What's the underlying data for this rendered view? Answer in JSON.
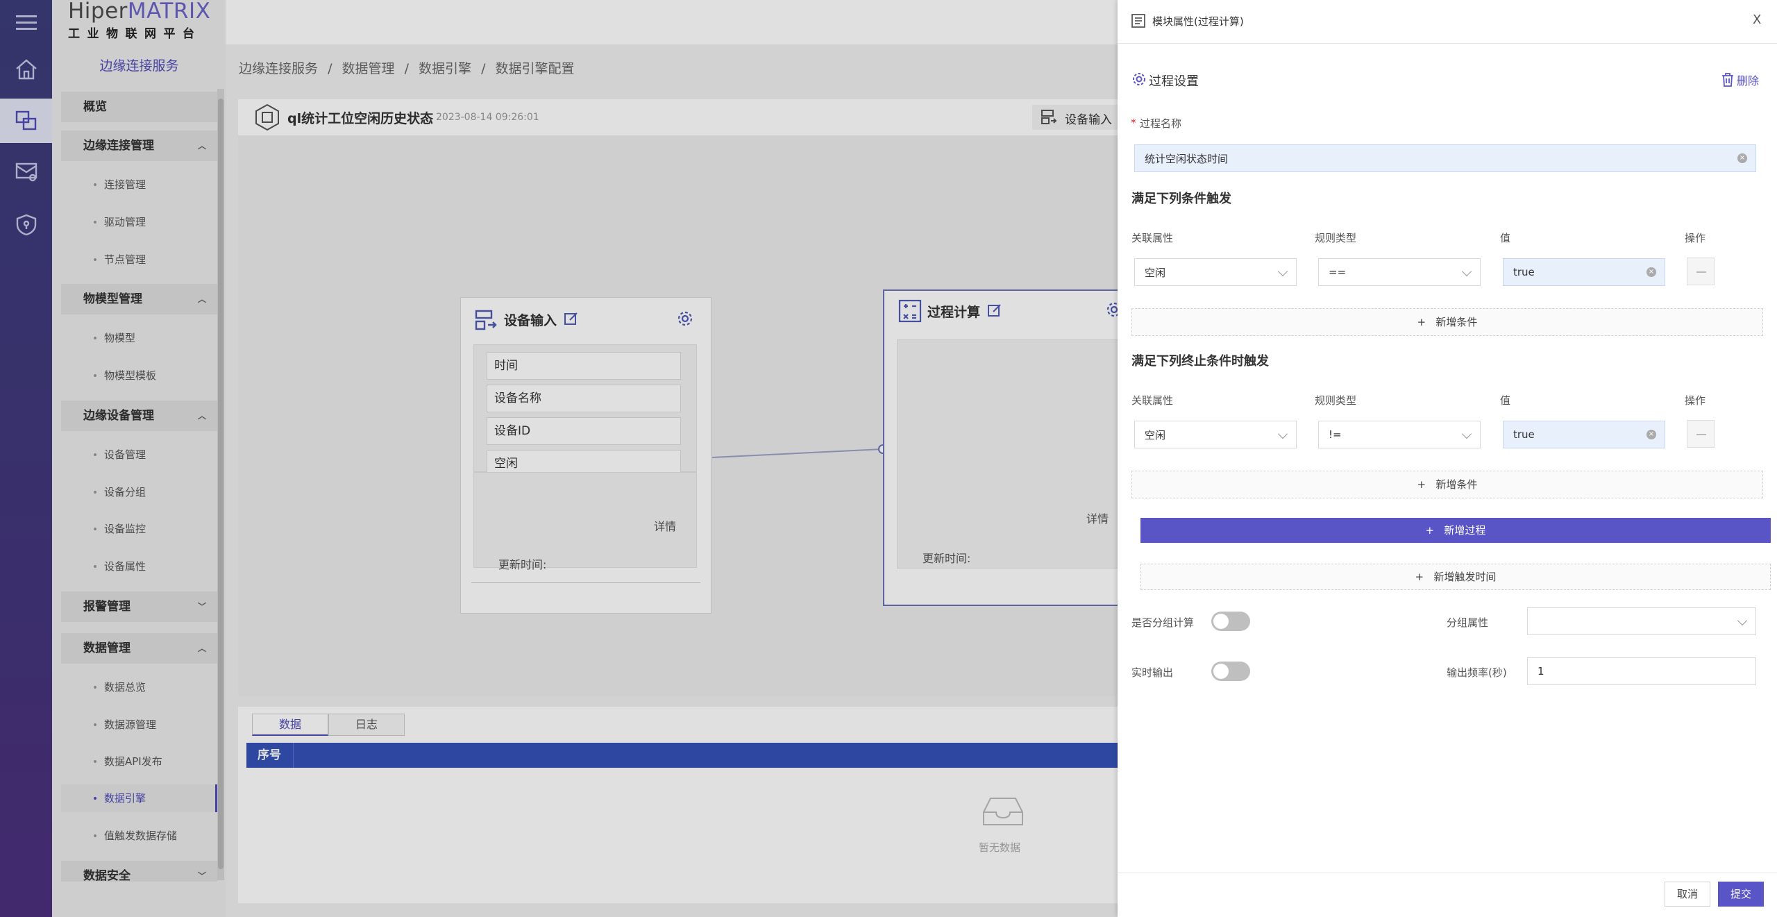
{
  "brand": {
    "hiper": "Hiper",
    "matrix": "MATRIX",
    "subtitle": "工业物联网平台"
  },
  "sidebar": {
    "service_title": "边缘连接服务",
    "groups": [
      {
        "label": "概览"
      },
      {
        "label": "边缘连接管理",
        "items": [
          "连接管理",
          "驱动管理",
          "节点管理"
        ]
      },
      {
        "label": "物模型管理",
        "items": [
          "物模型",
          "物模型模板"
        ]
      },
      {
        "label": "边缘设备管理",
        "items": [
          "设备管理",
          "设备分组",
          "设备监控",
          "设备属性"
        ]
      },
      {
        "label": "报警管理"
      },
      {
        "label": "数据管理",
        "items": [
          "数据总览",
          "数据源管理",
          "数据API发布",
          "数据引擎",
          "值触发数据存储"
        ]
      },
      {
        "label": "数据安全"
      }
    ]
  },
  "breadcrumb": [
    "边缘连接服务",
    "/",
    "数据管理",
    "/",
    "数据引擎",
    "/",
    "数据引擎配置"
  ],
  "flow": {
    "name": "ql统计工位空闲历史状态",
    "date": "2023-08-14 09:26:01",
    "toolbar_item": "设备输入",
    "device_node": {
      "title": "设备输入",
      "fields": [
        "时间",
        "设备名称",
        "设备ID",
        "空闲"
      ],
      "detail": "详情",
      "update_label": "更新时间:"
    },
    "process_node": {
      "title": "过程计算",
      "detail": "详情",
      "update_label": "更新时间:"
    }
  },
  "bottom_panel": {
    "tabs": [
      "数据",
      "日志"
    ],
    "col_header": "序号",
    "empty": "暂无数据"
  },
  "drawer": {
    "title": "模块属性(过程计算)",
    "close": "X",
    "section_title": "过程设置",
    "delete_label": "删除",
    "process_name_label": "过程名称",
    "required_mark": "*",
    "process_name_value": "统计空闲状态时间",
    "trigger": {
      "title": "满足下列条件触发",
      "headers": [
        "关联属性",
        "规则类型",
        "值",
        "操作"
      ],
      "row": {
        "attr": "空闲",
        "rule": "==",
        "value": "true"
      },
      "add": "新增条件"
    },
    "stop_trigger": {
      "title": "满足下列终止条件时触发",
      "headers": [
        "关联属性",
        "规则类型",
        "值",
        "操作"
      ],
      "row": {
        "attr": "空闲",
        "rule": "!=",
        "value": "true"
      },
      "add": "新增条件"
    },
    "add_process": "新增过程",
    "add_trigger_time": "新增触发时间",
    "group_calc_label": "是否分组计算",
    "group_attr_label": "分组属性",
    "group_attr_value": "",
    "realtime_label": "实时输出",
    "freq_label": "输出频率(秒)",
    "freq_value": "1",
    "cancel": "取消",
    "submit": "提交"
  },
  "colors": {
    "accent": "#5a55c7",
    "rail": "#3c3d7a",
    "table_header": "#3553b8"
  }
}
